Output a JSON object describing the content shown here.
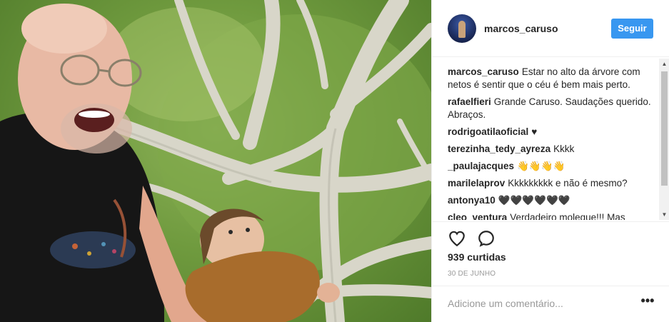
{
  "post": {
    "username": "marcos_caruso",
    "follow_label": "Seguir",
    "caption": {
      "user": "marcos_caruso",
      "text": "Estar no alto da árvore com netos é sentir que o céu é bem mais perto."
    },
    "comments": [
      {
        "user": "rafaelfieri",
        "text": "Grande Caruso. Saudações querido. Abraços."
      },
      {
        "user": "rodrigoatilaoficial",
        "text": "♥"
      },
      {
        "user": "terezinha_tedy_ayreza",
        "text": "Kkkk"
      },
      {
        "user": "_paulajacques",
        "text": "👋👋👋👋"
      },
      {
        "user": "marilelaprov",
        "text": "Kkkkkkkkk e não é mesmo?"
      },
      {
        "user": "antonya10",
        "text": "🖤🖤🖤🖤🖤🖤"
      },
      {
        "user": "cleo_ventura",
        "text": "Verdadeiro moleque!!! Mas"
      }
    ],
    "likes": "939 curtidas",
    "date": "30 DE JUNHO",
    "comment_placeholder": "Adicione um comentário...",
    "more_label": "•••"
  },
  "icons": {
    "like": "heart-icon",
    "comment": "comment-bubble-icon",
    "scroll_up": "scroll-up-arrow",
    "scroll_down": "scroll-down-arrow"
  },
  "colors": {
    "follow_button": "#3897f0",
    "text": "#262626",
    "muted": "#999999",
    "border": "#efefef"
  }
}
